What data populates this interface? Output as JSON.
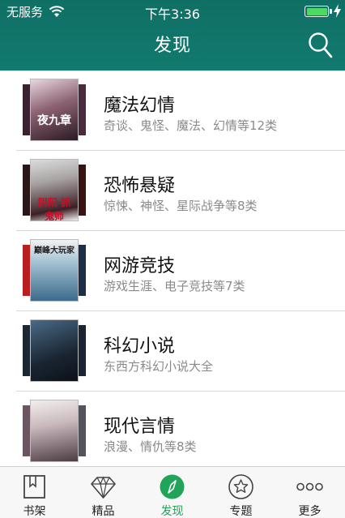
{
  "status_bar": {
    "carrier": "无服务",
    "time": "下午3:36",
    "battery_level": 1.0
  },
  "header": {
    "title": "发现",
    "search_icon": "search-icon"
  },
  "colors": {
    "header_bg": "#127a6f",
    "active_tab": "#21a35a",
    "battery": "#4cd964",
    "desc_text": "#8a8a8a"
  },
  "categories": [
    {
      "name": "魔法幻情",
      "desc": "奇谈、鬼怪、魔法、幻情等12类",
      "cover_text": "夜九章"
    },
    {
      "name": "恐怖悬疑",
      "desc": "惊悚、神怪、星际战争等8类",
      "cover_text": "阴阳 抓鬼师"
    },
    {
      "name": "网游竞技",
      "desc": "游戏生涯、电子竞技等7类",
      "cover_text": "巅峰大玩家"
    },
    {
      "name": "科幻小说",
      "desc": "东西方科幻小说大全",
      "cover_text": ""
    },
    {
      "name": "现代言情",
      "desc": "浪漫、情仇等8类",
      "cover_text": ""
    }
  ],
  "tabs": [
    {
      "label": "书架",
      "icon": "bookshelf-icon"
    },
    {
      "label": "精品",
      "icon": "diamond-icon"
    },
    {
      "label": "发现",
      "icon": "compass-icon",
      "active": true
    },
    {
      "label": "专题",
      "icon": "star-circle-icon"
    },
    {
      "label": "更多",
      "icon": "more-dots-icon"
    }
  ]
}
